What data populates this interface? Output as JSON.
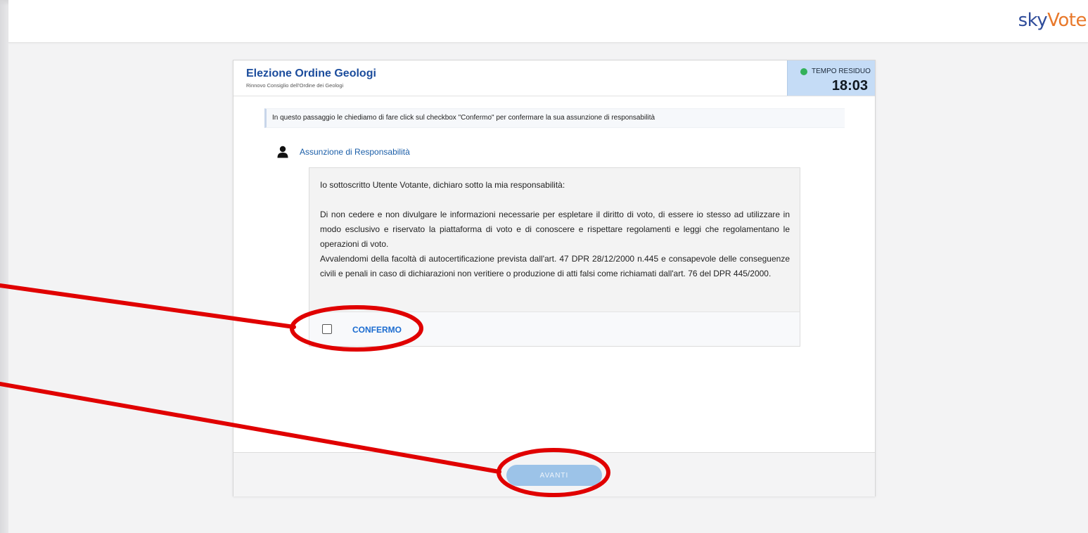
{
  "brand": {
    "logo_sky": "sky",
    "logo_vote": "Vote"
  },
  "election": {
    "title": "Elezione Ordine Geologi",
    "subtitle": "Rinnovo Consiglio dell'Ordine dei Geologi"
  },
  "timer": {
    "label": "TEMPO RESIDUO",
    "value": "18:03",
    "status_color": "#33b15a"
  },
  "info": {
    "text": "In questo passaggio le chiediamo di fare click sul checkbox \"Confermo\" per confermare la sua assunzione di responsabilità"
  },
  "section": {
    "icon": "user-icon",
    "title": "Assunzione di Responsabilità"
  },
  "declaration": {
    "intro": "Io sottoscritto Utente Votante, dichiaro sotto la mia responsabilità:",
    "paragraph1": "Di non cedere e non divulgare le informazioni necessarie per espletare il diritto di voto, di essere io stesso ad utilizzare in modo esclusivo e riservato la piattaforma di voto e di conoscere e rispettare regolamenti e leggi che regolamentano le operazioni di voto.",
    "paragraph2": "Avvalendomi della facoltà di autocertificazione prevista dall'art. 47 DPR 28/12/2000 n.445 e consapevole delle conseguenze civili e penali in caso di dichiarazioni non veritiere o produzione di atti falsi come richiamati dall'art. 76 del DPR 445/2000."
  },
  "confirm": {
    "label": "CONFERMO",
    "checked": false
  },
  "footer": {
    "next_label": "AVANTI",
    "next_enabled": false
  },
  "colors": {
    "accent": "#1b4c9c",
    "link": "#1b6cd0",
    "timer_bg": "#c5dcf6",
    "button_disabled": "#9cc3e8",
    "annotation": "#e00000"
  }
}
